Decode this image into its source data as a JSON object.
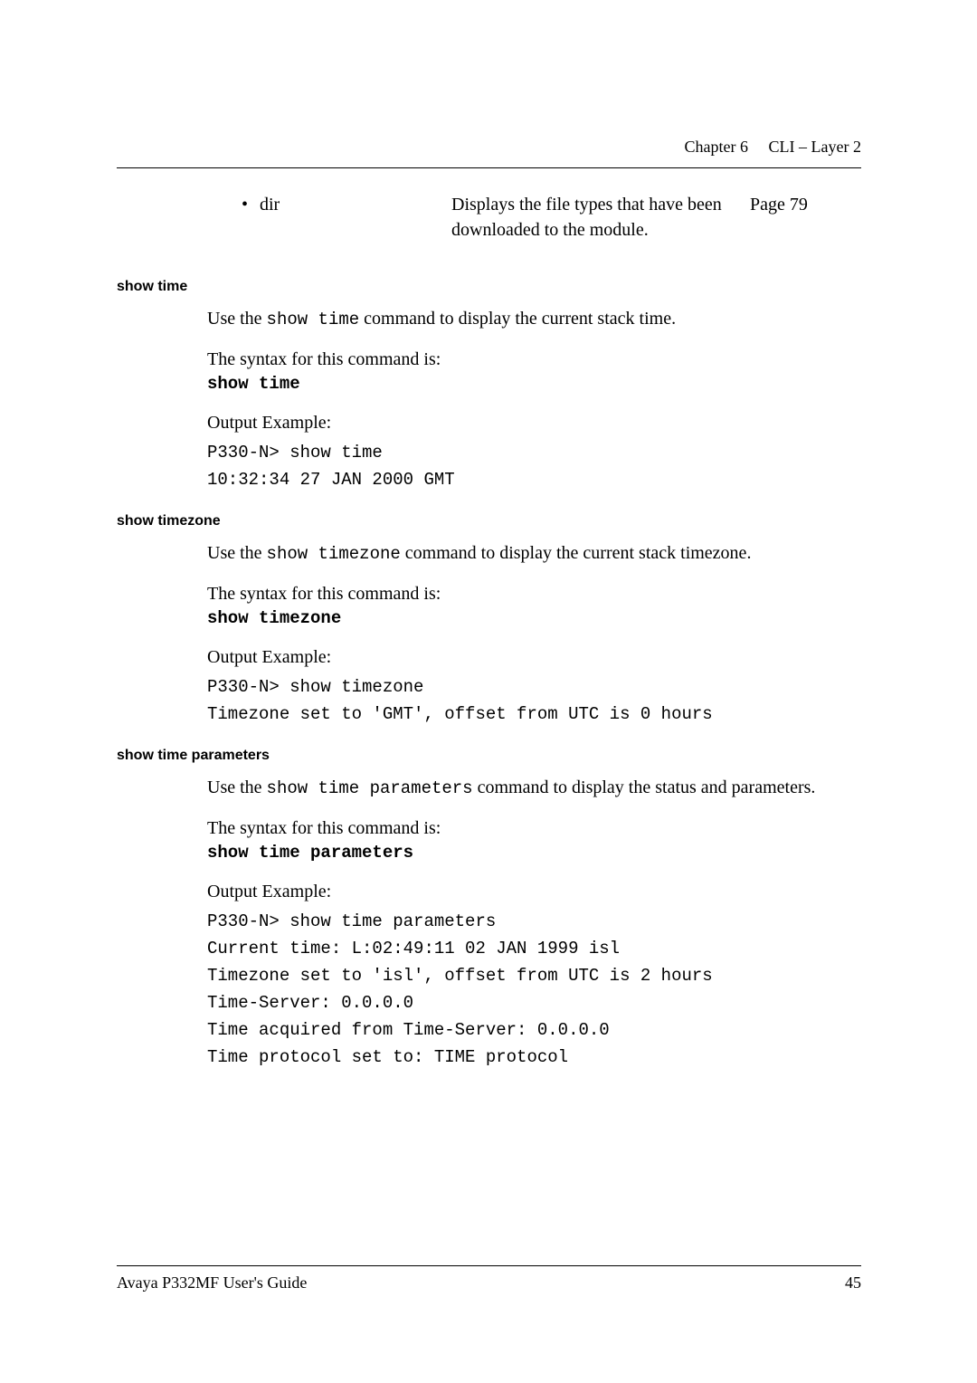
{
  "header": {
    "chapter": "Chapter 6",
    "title": "CLI – Layer 2"
  },
  "bullet": {
    "mark": "•",
    "label": "dir",
    "description": "Displays the file types that have been downloaded to the module.",
    "pageref": "Page 79"
  },
  "sections": {
    "show_time": {
      "heading": "show time",
      "intro_pre": "Use the ",
      "intro_cmd": "show time",
      "intro_post": " command to display the current stack time.",
      "syntax_label": "The syntax for this command is:",
      "syntax_cmd": "show time",
      "output_label": "Output Example:",
      "output": "P330-N> show time\n10:32:34 27 JAN 2000 GMT"
    },
    "show_timezone": {
      "heading": "show timezone",
      "intro_pre": "Use the ",
      "intro_cmd": "show timezone",
      "intro_post": " command to display the current stack timezone.",
      "syntax_label": "The syntax for this command is:",
      "syntax_cmd": "show timezone",
      "output_label": "Output Example:",
      "output": "P330-N> show timezone\nTimezone set to 'GMT', offset from UTC is 0 hours"
    },
    "show_time_parameters": {
      "heading": "show time parameters",
      "intro_pre": "Use the ",
      "intro_cmd": "show time parameters",
      "intro_post": " command to display the status and parameters.",
      "syntax_label": "The syntax for this command is:",
      "syntax_cmd": "show time parameters",
      "output_label": "Output Example:",
      "output": "P330-N> show time parameters\nCurrent time: L:02:49:11 02 JAN 1999 isl\nTimezone set to 'isl', offset from UTC is 2 hours\nTime-Server: 0.0.0.0\nTime acquired from Time-Server: 0.0.0.0\nTime protocol set to: TIME protocol"
    }
  },
  "footer": {
    "left": "Avaya P332MF User's Guide",
    "right": "45"
  }
}
